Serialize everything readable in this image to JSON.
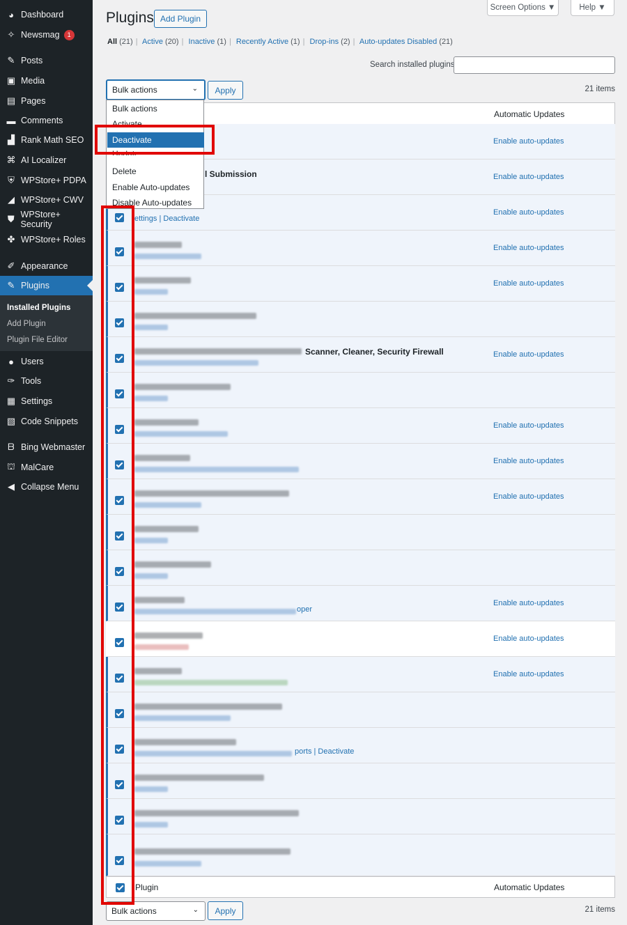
{
  "sidebar": {
    "items": [
      {
        "label": "Dashboard",
        "icon": "dashboard-icon",
        "glyph": "◕"
      },
      {
        "label": "Newsmag",
        "icon": "newsmag-icon",
        "glyph": "✧",
        "badge": "1"
      },
      {
        "label": "Posts",
        "icon": "pin-icon",
        "glyph": "✎"
      },
      {
        "label": "Media",
        "icon": "media-icon",
        "glyph": "▣"
      },
      {
        "label": "Pages",
        "icon": "pages-icon",
        "glyph": "▤"
      },
      {
        "label": "Comments",
        "icon": "comment-icon",
        "glyph": "▬"
      },
      {
        "label": "Rank Math SEO",
        "icon": "rankmath-icon",
        "glyph": "▟"
      },
      {
        "label": "AI Localizer",
        "icon": "translate-icon",
        "glyph": "⌘"
      },
      {
        "label": "WPStore+ PDPA",
        "icon": "shield-icon",
        "glyph": "⛨"
      },
      {
        "label": "WPStore+ CWV",
        "icon": "chart-icon",
        "glyph": "◢"
      },
      {
        "label": "WPStore+ Security",
        "icon": "shield-icon",
        "glyph": "⛊"
      },
      {
        "label": "WPStore+ Roles",
        "icon": "users-icon",
        "glyph": "✤"
      },
      {
        "label": "Appearance",
        "icon": "brush-icon",
        "glyph": "✐"
      },
      {
        "label": "Plugins",
        "icon": "plugins-icon",
        "glyph": "✎"
      },
      {
        "label": "Users",
        "icon": "user-icon",
        "glyph": "●"
      },
      {
        "label": "Tools",
        "icon": "wrench-icon",
        "glyph": "✑"
      },
      {
        "label": "Settings",
        "icon": "settings-icon",
        "glyph": "▦"
      },
      {
        "label": "Code Snippets",
        "icon": "code-icon",
        "glyph": "▧"
      },
      {
        "label": "Bing Webmaster",
        "icon": "bing-icon",
        "glyph": "ᗷ"
      },
      {
        "label": "MalCare",
        "icon": "malcare-icon",
        "glyph": "⛫"
      },
      {
        "label": "Collapse Menu",
        "icon": "collapse-icon",
        "glyph": "◀"
      }
    ],
    "submenu": [
      "Installed Plugins",
      "Add Plugin",
      "Plugin File Editor"
    ]
  },
  "header": {
    "title": "Plugins",
    "add_plugin": "Add Plugin",
    "screen_options": "Screen Options ▼",
    "help": "Help ▼"
  },
  "filters": {
    "all": "All",
    "all_count": "(21)",
    "active": "Active",
    "active_count": "(20)",
    "inactive": "Inactive",
    "inactive_count": "(1)",
    "recent": "Recently Active",
    "recent_count": "(1)",
    "dropins": "Drop-ins",
    "dropins_count": "(2)",
    "autodisabled": "Auto-updates Disabled",
    "autodisabled_count": "(21)",
    "separator": "|"
  },
  "search": {
    "label": "Search installed plugins",
    "value": ""
  },
  "bulk": {
    "label": "Bulk actions",
    "apply": "Apply",
    "items": "21 items"
  },
  "dropdown": {
    "options": [
      "Bulk actions",
      "Activate",
      "Deactivate",
      "Update",
      "Delete",
      "Enable Auto-updates",
      "Disable Auto-updates"
    ]
  },
  "table": {
    "col_plugin": "Plugin",
    "col_auto": "Automatic Updates",
    "enable_auto": "Enable auto-updates",
    "row2_name_tail": "l Submission",
    "row3_actions": "ettings | Deactivate",
    "row8_name_tail": "Scanner, Cleaner, Security Firewall",
    "row14_actions_tail": "oper",
    "row19_actions_tail": "ports | Deactivate"
  }
}
